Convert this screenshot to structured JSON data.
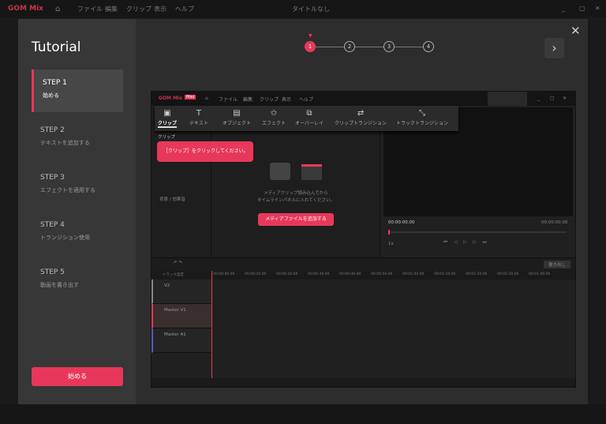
{
  "app": {
    "logo": "GOM Mix",
    "menu": [
      "ファイル",
      "編集",
      "クリップ",
      "表示",
      "ヘルプ"
    ],
    "doc_title": "タイトルなし"
  },
  "tutorial": {
    "title": "Tutorial",
    "steps": [
      {
        "label": "STEP 1",
        "desc": "始める"
      },
      {
        "label": "STEP 2",
        "desc": "テキストを追加する"
      },
      {
        "label": "STEP 3",
        "desc": "エフェクトを適用する"
      },
      {
        "label": "STEP 4",
        "desc": "トランジション使用"
      },
      {
        "label": "STEP 5",
        "desc": "動画を書き出す"
      }
    ],
    "active_step": 1,
    "start_label": "始める",
    "pages": [
      "1",
      "2",
      "3",
      "4"
    ],
    "current_page": 1,
    "next_icon": "›",
    "close_icon": "✕"
  },
  "preview": {
    "logo": "GOM Mix",
    "badge": "Max",
    "menu": [
      "ファイル",
      "編集",
      "クリップ",
      "表示",
      "ヘルプ"
    ],
    "tools": [
      {
        "icon": "▣",
        "label": "クリップ"
      },
      {
        "icon": "T",
        "label": "テキスト"
      },
      {
        "icon": "▤",
        "label": "オブジェクト"
      },
      {
        "icon": "✩",
        "label": "エフェクト"
      },
      {
        "icon": "⧉",
        "label": "オーバーレイ"
      },
      {
        "icon": "⇄",
        "label": "クリップトランジション"
      },
      {
        "icon": "⤡",
        "label": "トラックトランジション"
      }
    ],
    "tooltip": "［クリップ］をクリックしてください。",
    "sidebar": [
      "クリップ",
      "背景 / 効果音"
    ],
    "media_hint_1": "メディアクリップ読み込んでから",
    "media_hint_2": "タイムラインパネルに入れてください。",
    "add_media": "メディアファイルを追加する",
    "time_current": "00:00:00.00",
    "time_total": "00:00:00.00",
    "speed": "1x",
    "export": "書き出し",
    "track_settings": "トラック設定",
    "ruler": [
      "00:00:00.00",
      "00:00:10.00",
      "00:00:20.00",
      "00:00:30.00",
      "00:00:40.00",
      "00:00:50.00",
      "00:01:00.00",
      "00:01:10.00",
      "00:01:20.00",
      "00:01:30.00",
      "00:01:40.00"
    ],
    "tracks": [
      "V2",
      "Master V1",
      "Master A1"
    ]
  }
}
